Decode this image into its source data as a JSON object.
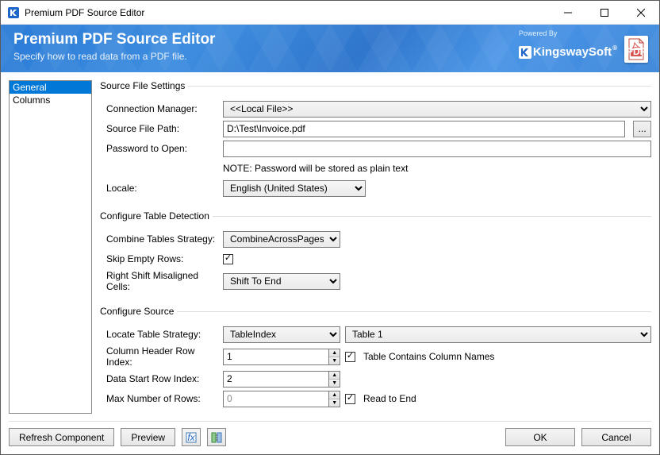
{
  "window": {
    "title": "Premium PDF Source Editor"
  },
  "banner": {
    "heading": "Premium PDF Source Editor",
    "subtitle": "Specify how to read data from a PDF file.",
    "powered_by": "Powered By",
    "brand": "KingswaySoft",
    "pdf_badge": "PDF"
  },
  "sidebar": {
    "items": [
      {
        "label": "General",
        "selected": true
      },
      {
        "label": "Columns",
        "selected": false
      }
    ]
  },
  "source_file_settings": {
    "legend": "Source File Settings",
    "connection_manager_label": "Connection Manager:",
    "connection_manager_value": "<<Local File>>",
    "source_file_path_label": "Source File Path:",
    "source_file_path_value": "D:\\Test\\Invoice.pdf",
    "browse_button": "...",
    "password_label": "Password to Open:",
    "password_value": "",
    "password_note": "NOTE: Password will be stored as plain text",
    "locale_label": "Locale:",
    "locale_value": "English (United States)"
  },
  "table_detection": {
    "legend": "Configure Table Detection",
    "combine_strategy_label": "Combine Tables Strategy:",
    "combine_strategy_value": "CombineAcrossPages",
    "skip_empty_rows_label": "Skip Empty Rows:",
    "skip_empty_rows_checked": true,
    "right_shift_label": "Right Shift Misaligned Cells:",
    "right_shift_value": "Shift To End"
  },
  "configure_source": {
    "legend": "Configure Source",
    "locate_strategy_label": "Locate Table Strategy:",
    "locate_strategy_value": "TableIndex",
    "table_select_value": "Table 1",
    "header_row_index_label": "Column Header Row Index:",
    "header_row_index_value": "1",
    "contains_names_label": "Table Contains Column Names",
    "contains_names_checked": true,
    "data_start_row_label": "Data Start Row Index:",
    "data_start_row_value": "2",
    "max_rows_label": "Max Number of Rows:",
    "max_rows_value": "0",
    "read_to_end_label": "Read to End",
    "read_to_end_checked": true
  },
  "footer": {
    "refresh": "Refresh Component",
    "preview": "Preview",
    "ok": "OK",
    "cancel": "Cancel"
  }
}
